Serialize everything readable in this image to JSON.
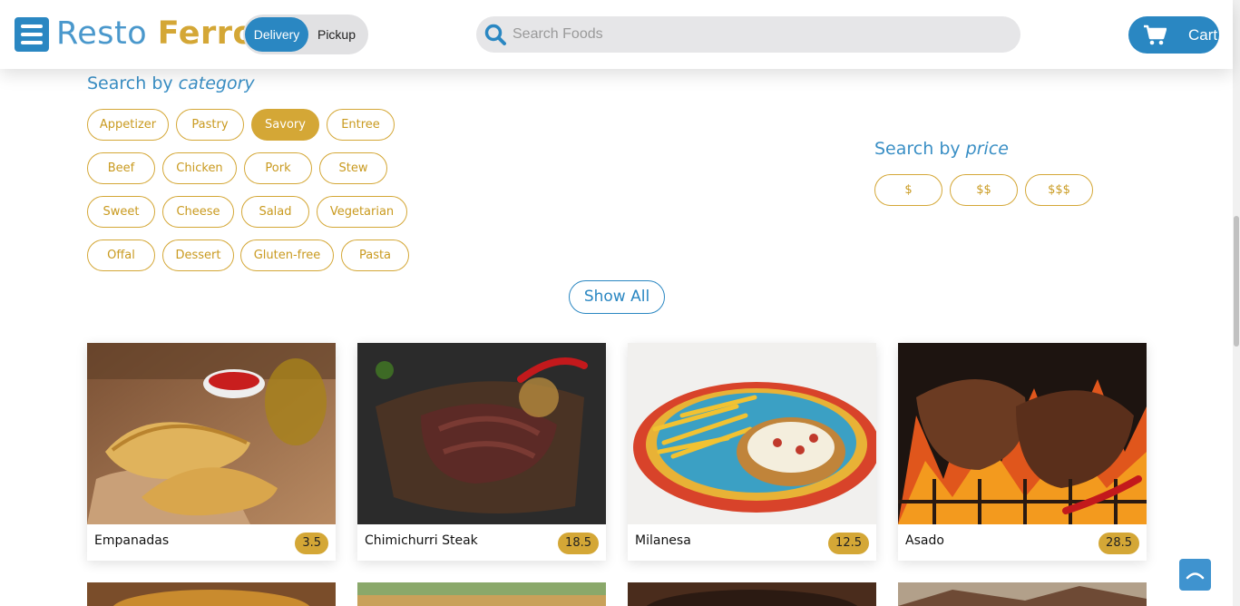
{
  "header": {
    "brand_part1": "Resto",
    "brand_part2": "Ferro",
    "delivery_label": "Delivery",
    "pickup_label": "Pickup",
    "search_placeholder": "Search Foods",
    "cart_label": "Cart"
  },
  "category_section": {
    "title_prefix": "Search by",
    "title_emphasis": "category",
    "categories": [
      "Appetizer",
      "Pastry",
      "Savory",
      "Entree",
      "Beef",
      "Chicken",
      "Pork",
      "Stew",
      "Sweet",
      "Cheese",
      "Salad",
      "Vegetarian",
      "Offal",
      "Dessert",
      "Gluten-free",
      "Pasta"
    ],
    "selected": "Savory"
  },
  "price_section": {
    "title_prefix": "Search by",
    "title_emphasis": "price",
    "options": [
      "$",
      "$$",
      "$$$"
    ]
  },
  "show_all_label": "Show All",
  "foods": [
    {
      "name": "Empanadas",
      "price": "3.5"
    },
    {
      "name": "Chimichurri Steak",
      "price": "18.5"
    },
    {
      "name": "Milanesa",
      "price": "12.5"
    },
    {
      "name": "Asado",
      "price": "28.5"
    }
  ],
  "colors": {
    "primary_blue": "#2a87c2",
    "accent_gold": "#d4a736"
  },
  "icons": {
    "menu": "hamburger-menu-icon",
    "search": "magnifier-icon",
    "cart": "shopping-cart-icon",
    "scroll_top": "chevron-up-icon"
  }
}
